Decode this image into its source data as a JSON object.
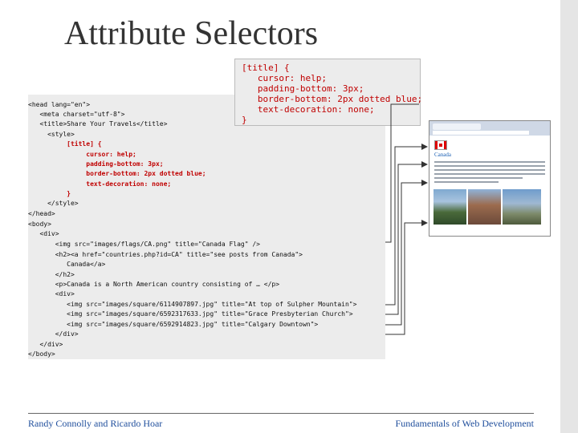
{
  "slide": {
    "title": "Attribute Selectors"
  },
  "code": {
    "lines": [
      "<head lang=\"en\">",
      "   <meta charset=\"utf-8\">",
      "   <title>Share Your Travels</title>",
      "     <style>",
      "          [title] {",
      "               cursor: help;",
      "               padding-bottom: 3px;",
      "               border-bottom: 2px dotted blue;",
      "               text-decoration: none;",
      "          }",
      "     </style>",
      "</head>",
      "<body>",
      "   <div>",
      "       <img src=\"images/flags/CA.png\" title=\"Canada Flag\" />",
      "       <h2><a href=\"countries.php?id=CA\" title=\"see posts from Canada\">",
      "          Canada</a>",
      "       </h2>",
      "       <p>Canada is a North American country consisting of … </p>",
      "       <div>",
      "          <img src=\"images/square/6114907897.jpg\" title=\"At top of Sulpher Mountain\">",
      "          <img src=\"images/square/6592317633.jpg\" title=\"Grace Presbyterian Church\">",
      "          <img src=\"images/square/6592914823.jpg\" title=\"Calgary Downtown\">",
      "       </div>",
      "   </div>",
      "</body>"
    ]
  },
  "callout": {
    "lines": [
      "[title] {",
      "   cursor: help;",
      "   padding-bottom: 3px;",
      "   border-bottom: 2px dotted blue;",
      "   text-decoration: none;",
      "}"
    ]
  },
  "browser": {
    "heading": "Canada"
  },
  "footer": {
    "authors": "Randy Connolly and Ricardo Hoar",
    "book": "Fundamentals of Web Development"
  },
  "colors": {
    "highlight": "#c00000",
    "footer_text": "#1f4e9c",
    "code_bg": "#ececec"
  }
}
